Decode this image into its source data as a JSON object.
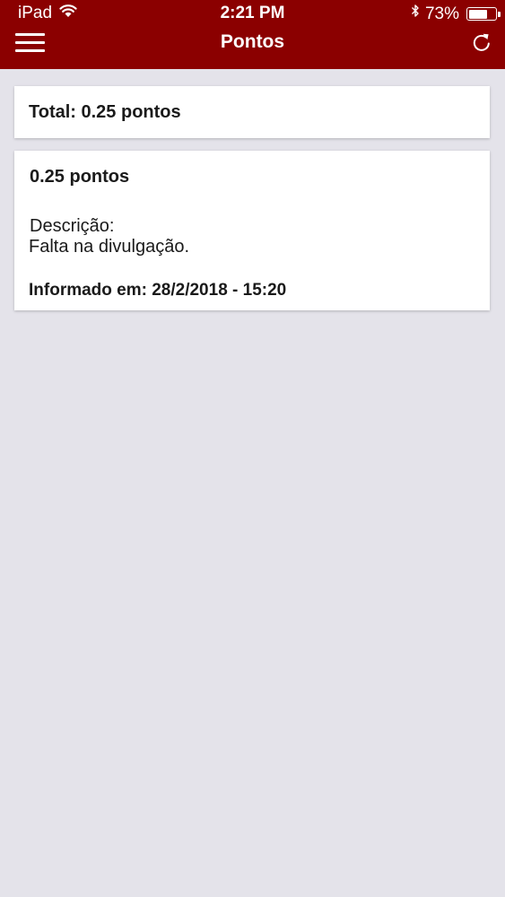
{
  "status_bar": {
    "device": "iPad",
    "wifi_icon": "wifi-icon",
    "time": "2:21 PM",
    "bluetooth_icon": "bluetooth-icon",
    "battery_percent": "73%",
    "battery_level": 0.73
  },
  "header": {
    "title": "Pontos",
    "menu_icon": "hamburger-menu-icon",
    "refresh_icon": "refresh-icon",
    "background_color": "#8b0000"
  },
  "summary": {
    "total": "Total: 0.25 pontos"
  },
  "entries": [
    {
      "points": "0.25 pontos",
      "description_label": "Descrição:",
      "description": "Falta na divulgação.",
      "informed": "Informado em: 28/2/2018 - 15:20"
    }
  ]
}
